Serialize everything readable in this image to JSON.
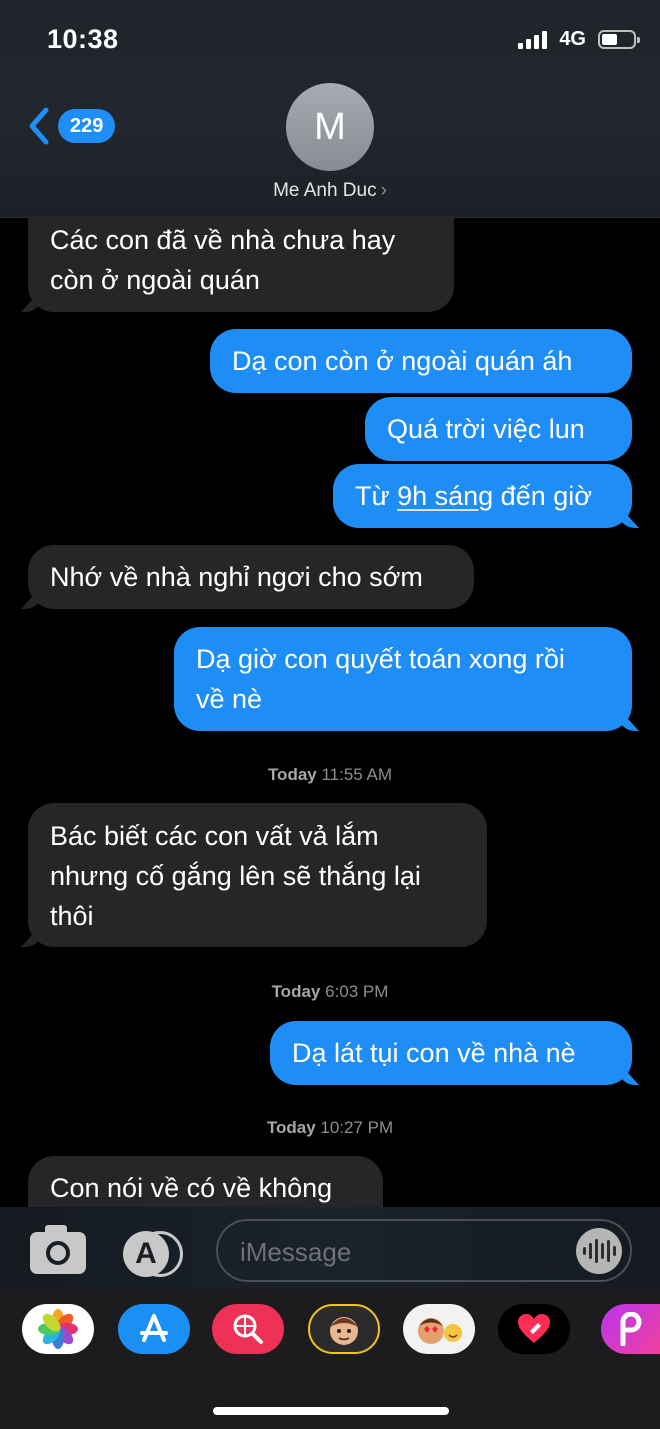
{
  "status": {
    "time": "10:38",
    "network": "4G"
  },
  "nav": {
    "back_count": "229"
  },
  "contact": {
    "initial": "M",
    "name": "Me Anh Duc",
    "chevron": "›"
  },
  "messages": [
    {
      "side": "received",
      "lines": [
        "Các con đã về nhà chưa hay",
        "còn ở ngoài quán"
      ]
    },
    {
      "side": "sent",
      "text": "Dạ con còn ở ngoài quán áh"
    },
    {
      "side": "sent",
      "text": "Quá trời việc lun"
    },
    {
      "side": "sent",
      "pre": "Từ ",
      "link": "9h sáng",
      "post": " đến giờ"
    },
    {
      "side": "received",
      "text": "Nhớ về nhà nghỉ ngơi cho sớm"
    },
    {
      "side": "sent",
      "lines": [
        "Dạ giờ con quyết toán xong rồi",
        "về nè"
      ]
    },
    {
      "side": "received",
      "lines": [
        "Bác biết các con vất vả lắm",
        "nhưng cố gắng lên sẽ thắng lại",
        "thôi"
      ]
    },
    {
      "side": "sent",
      "text": "Dạ lát tụi con về nhà nè"
    },
    {
      "side": "received",
      "text": "Con nói về có về không"
    }
  ],
  "timestamps": [
    {
      "day": "Today",
      "time": "11:55 AM"
    },
    {
      "day": "Today",
      "time": "6:03 PM"
    },
    {
      "day": "Today",
      "time": "10:27 PM"
    }
  ],
  "compose": {
    "placeholder": "iMessage"
  },
  "tray_apps": [
    "photos-icon",
    "app-store-icon",
    "web-search-icon",
    "memoji-icon",
    "animoji-stickers-icon",
    "digital-touch-icon",
    "picsart-icon"
  ],
  "colors": {
    "sent_bubble": "#1e8df6",
    "received_bubble": "#262628",
    "badge": "#1f8ef7"
  }
}
